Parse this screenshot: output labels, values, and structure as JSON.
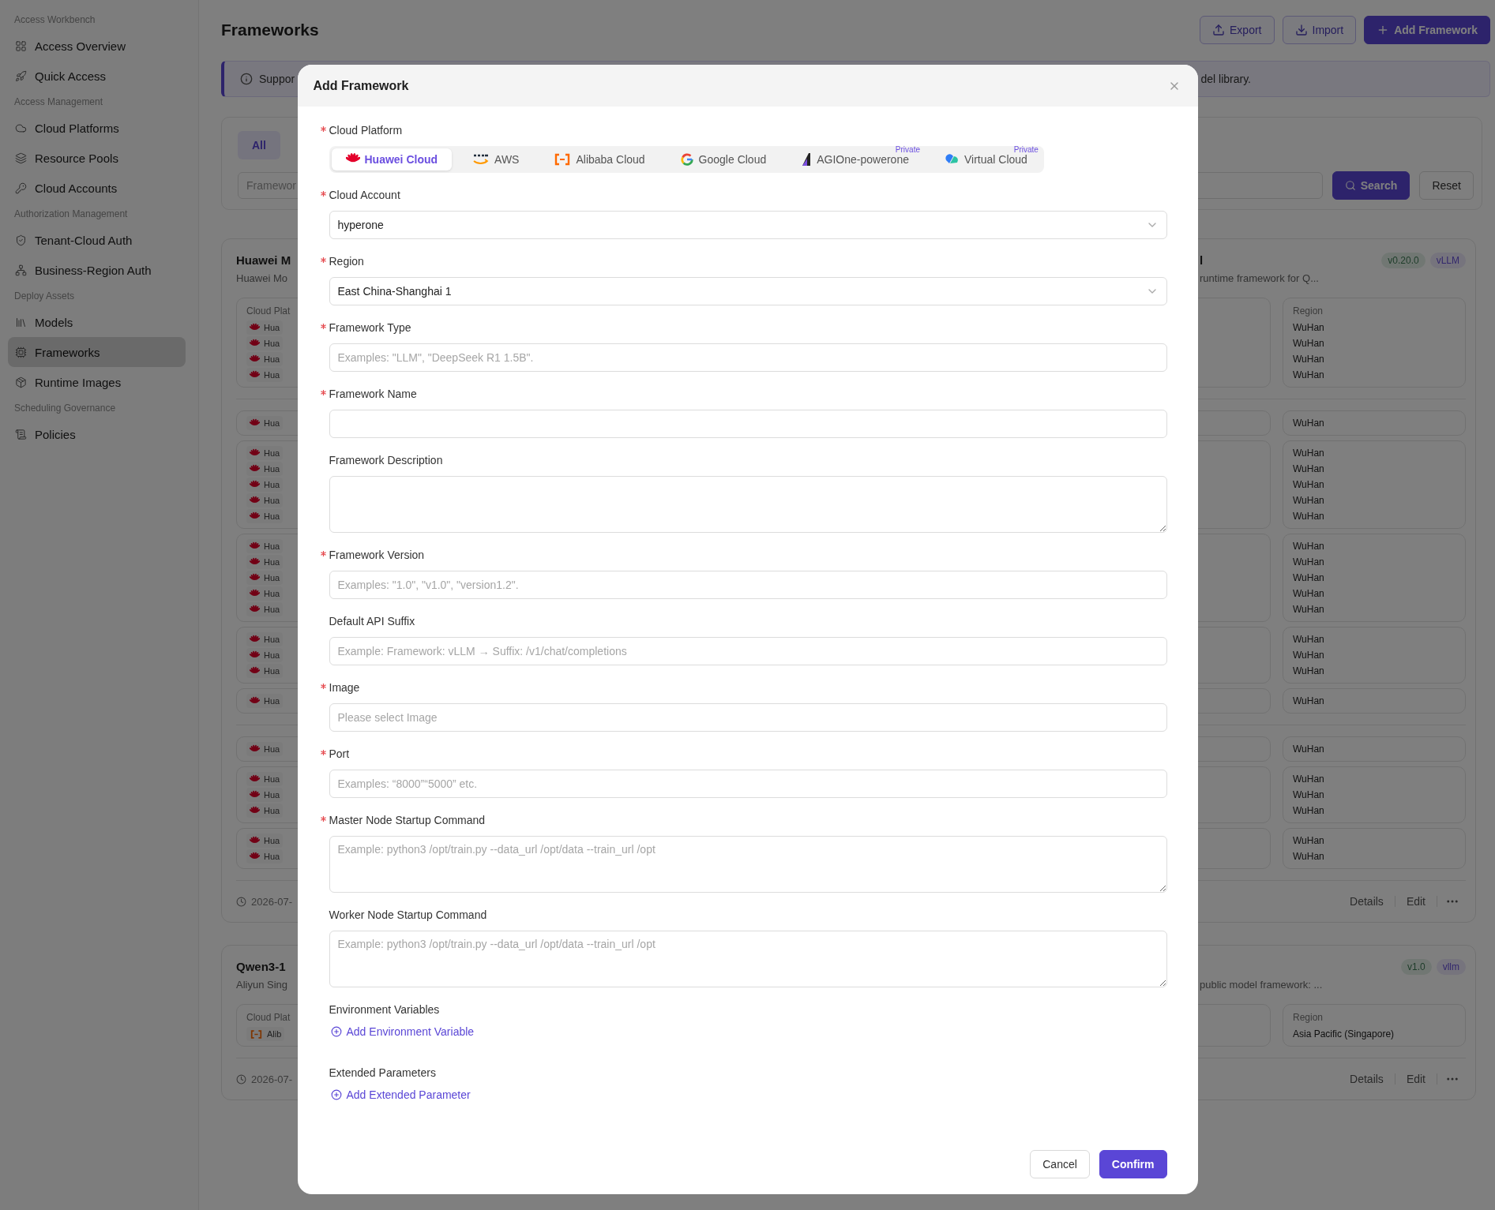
{
  "sidebar": {
    "groups": [
      {
        "label": "Access Workbench",
        "items": [
          {
            "label": "Access Overview",
            "selected": false
          },
          {
            "label": "Quick Access",
            "selected": false
          }
        ]
      },
      {
        "label": "Access Management",
        "items": [
          {
            "label": "Cloud Platforms",
            "selected": false
          },
          {
            "label": "Resource Pools",
            "selected": false
          },
          {
            "label": "Cloud Accounts",
            "selected": false
          }
        ]
      },
      {
        "label": "Authorization Management",
        "items": [
          {
            "label": "Tenant-Cloud Auth",
            "selected": false
          },
          {
            "label": "Business-Region Auth",
            "selected": false
          }
        ]
      },
      {
        "label": "Deploy Assets",
        "items": [
          {
            "label": "Models",
            "selected": false
          },
          {
            "label": "Frameworks",
            "selected": true
          },
          {
            "label": "Runtime Images",
            "selected": false
          }
        ]
      },
      {
        "label": "Scheduling Governance",
        "items": [
          {
            "label": "Policies",
            "selected": false
          }
        ]
      }
    ]
  },
  "page": {
    "title": "Frameworks",
    "actions": [
      {
        "label": "Export",
        "kind": "export"
      },
      {
        "label": "Import",
        "kind": "import"
      },
      {
        "label": "Add Framework",
        "kind": "add"
      }
    ]
  },
  "banner": {
    "text_start": "Suppor",
    "text_end": "del library."
  },
  "filters": {
    "tabs": [
      {
        "label": "All",
        "selected": true
      }
    ],
    "search": {
      "placeholder": "Framewor"
    },
    "buttons": [
      {
        "label": "Search",
        "kind": "primary"
      },
      {
        "label": "Reset",
        "kind": "default"
      }
    ]
  },
  "cards": [
    {
      "title": "Huawei M",
      "title_end": "l",
      "description": "Huawei Mo",
      "description_end": "runtime framework for Q...",
      "tags": [
        {
          "label": "v0.20.0",
          "kind": "version"
        },
        {
          "label": "vLLM",
          "kind": "framework"
        }
      ],
      "sections": [
        {
          "rows": [
            {
              "platform_heading": "Cloud Plat",
              "region_heading": "Region",
              "platforms": [
                {
                  "label": "Hua",
                  "kind": "huawei"
                },
                {
                  "label": "Hua",
                  "kind": "huawei"
                },
                {
                  "label": "Hua",
                  "kind": "huawei"
                },
                {
                  "label": "Hua",
                  "kind": "huawei"
                }
              ],
              "regions": [
                "WuHan",
                "WuHan",
                "WuHan",
                "WuHan"
              ]
            }
          ]
        },
        {
          "rows": [
            {
              "platforms": [
                {
                  "label": "Hua",
                  "kind": "huawei"
                }
              ],
              "regions": [
                "WuHan"
              ]
            },
            {
              "platforms": [
                {
                  "label": "Hua",
                  "kind": "huawei"
                },
                {
                  "label": "Hua",
                  "kind": "huawei"
                },
                {
                  "label": "Hua",
                  "kind": "huawei"
                },
                {
                  "label": "Hua",
                  "kind": "huawei"
                },
                {
                  "label": "Hua",
                  "kind": "huawei"
                }
              ],
              "regions": [
                "WuHan",
                "WuHan",
                "WuHan",
                "WuHan",
                "WuHan"
              ]
            },
            {
              "platforms": [
                {
                  "label": "Hua",
                  "kind": "huawei"
                },
                {
                  "label": "Hua",
                  "kind": "huawei"
                },
                {
                  "label": "Hua",
                  "kind": "huawei"
                },
                {
                  "label": "Hua",
                  "kind": "huawei"
                },
                {
                  "label": "Hua",
                  "kind": "huawei"
                }
              ],
              "regions": [
                "WuHan",
                "WuHan",
                "WuHan",
                "WuHan",
                "WuHan"
              ]
            },
            {
              "platforms": [
                {
                  "label": "Hua",
                  "kind": "huawei"
                },
                {
                  "label": "Hua",
                  "kind": "huawei"
                },
                {
                  "label": "Hua",
                  "kind": "huawei"
                }
              ],
              "regions": [
                "WuHan",
                "WuHan",
                "WuHan"
              ]
            },
            {
              "platforms": [
                {
                  "label": "Hua",
                  "kind": "huawei"
                }
              ],
              "regions": [
                "WuHan"
              ]
            }
          ]
        },
        {
          "rows": [
            {
              "platforms": [
                {
                  "label": "Hua",
                  "kind": "huawei"
                }
              ],
              "regions": [
                "WuHan"
              ]
            },
            {
              "platforms": [
                {
                  "label": "Hua",
                  "kind": "huawei"
                },
                {
                  "label": "Hua",
                  "kind": "huawei"
                },
                {
                  "label": "Hua",
                  "kind": "huawei"
                }
              ],
              "regions": [
                "WuHan",
                "WuHan",
                "WuHan"
              ]
            },
            {
              "platforms": [
                {
                  "label": "Hua",
                  "kind": "huawei"
                },
                {
                  "label": "Hua",
                  "kind": "huawei"
                }
              ],
              "regions": [
                "WuHan",
                "WuHan"
              ]
            }
          ]
        }
      ],
      "date": "2026-07-",
      "actions": [
        "Details",
        "Edit"
      ]
    },
    {
      "title": "Qwen3-1",
      "description": "Aliyun Sing",
      "description_end": "public model framework: ...",
      "tags": [
        {
          "label": "v1.0",
          "kind": "version"
        },
        {
          "label": "vllm",
          "kind": "framework"
        }
      ],
      "sections": [
        {
          "rows": [
            {
              "platform_heading": "Cloud Plat",
              "region_heading": "Region",
              "platforms": [
                {
                  "label": "Alib",
                  "kind": "alibaba"
                }
              ],
              "regions": [
                "Asia Pacific (Singapore)"
              ]
            }
          ]
        }
      ],
      "date": "2026-07-",
      "actions": [
        "Details",
        "Edit"
      ]
    }
  ],
  "dialog": {
    "title": "Add Framework",
    "platform": {
      "label": "Cloud Platform",
      "required": true,
      "options": [
        {
          "label": "Huawei Cloud",
          "kind": "huawei",
          "selected": true
        },
        {
          "label": "AWS",
          "kind": "aws",
          "selected": false
        },
        {
          "label": "Alibaba Cloud",
          "kind": "alibaba",
          "selected": false
        },
        {
          "label": "Google Cloud",
          "kind": "google",
          "selected": false
        },
        {
          "label": "AGIOne-powerone",
          "kind": "agione",
          "selected": false,
          "badge": "Private"
        },
        {
          "label": "Virtual Cloud",
          "kind": "virtual",
          "selected": false,
          "badge": "Private"
        }
      ]
    },
    "fields": [
      {
        "label": "Cloud Account",
        "required": true,
        "kind": "select",
        "value": "hyperone"
      },
      {
        "label": "Region",
        "required": true,
        "kind": "select",
        "value": "East China-Shanghai 1"
      },
      {
        "label": "Framework Type",
        "required": true,
        "kind": "input",
        "placeholder": "Examples: \"LLM\", \"DeepSeek R1 1.5B\"."
      },
      {
        "label": "Framework Name",
        "required": true,
        "kind": "input"
      },
      {
        "label": "Framework Description",
        "required": false,
        "kind": "textarea"
      },
      {
        "label": "Framework Version",
        "required": true,
        "kind": "input",
        "placeholder": "Examples: \"1.0\", \"v1.0\", \"version1.2\"."
      },
      {
        "label": "Default API Suffix",
        "required": false,
        "kind": "input",
        "placeholder": "Example: Framework: vLLM → Suffix: /v1/chat/completions"
      },
      {
        "label": "Image",
        "required": true,
        "kind": "input",
        "placeholder": "Please select Image"
      },
      {
        "label": "Port",
        "required": true,
        "kind": "input",
        "placeholder": "Examples: “8000”“5000” etc."
      },
      {
        "label": "Master Node Startup Command",
        "required": true,
        "kind": "textarea",
        "placeholder": "Example: python3 /opt/train.py --data_url /opt/data --train_url /opt"
      },
      {
        "label": "Worker Node Startup Command",
        "required": false,
        "kind": "textarea",
        "placeholder": "Example: python3 /opt/train.py --data_url /opt/data --train_url /opt"
      },
      {
        "label": "Environment Variables",
        "required": false,
        "kind": "list",
        "action": "Add Environment Variable"
      },
      {
        "label": "Extended Parameters",
        "required": false,
        "kind": "list",
        "action": "Add Extended Parameter"
      }
    ],
    "buttons": [
      {
        "label": "Cancel",
        "kind": "default"
      },
      {
        "label": "Confirm",
        "kind": "primary"
      }
    ]
  }
}
